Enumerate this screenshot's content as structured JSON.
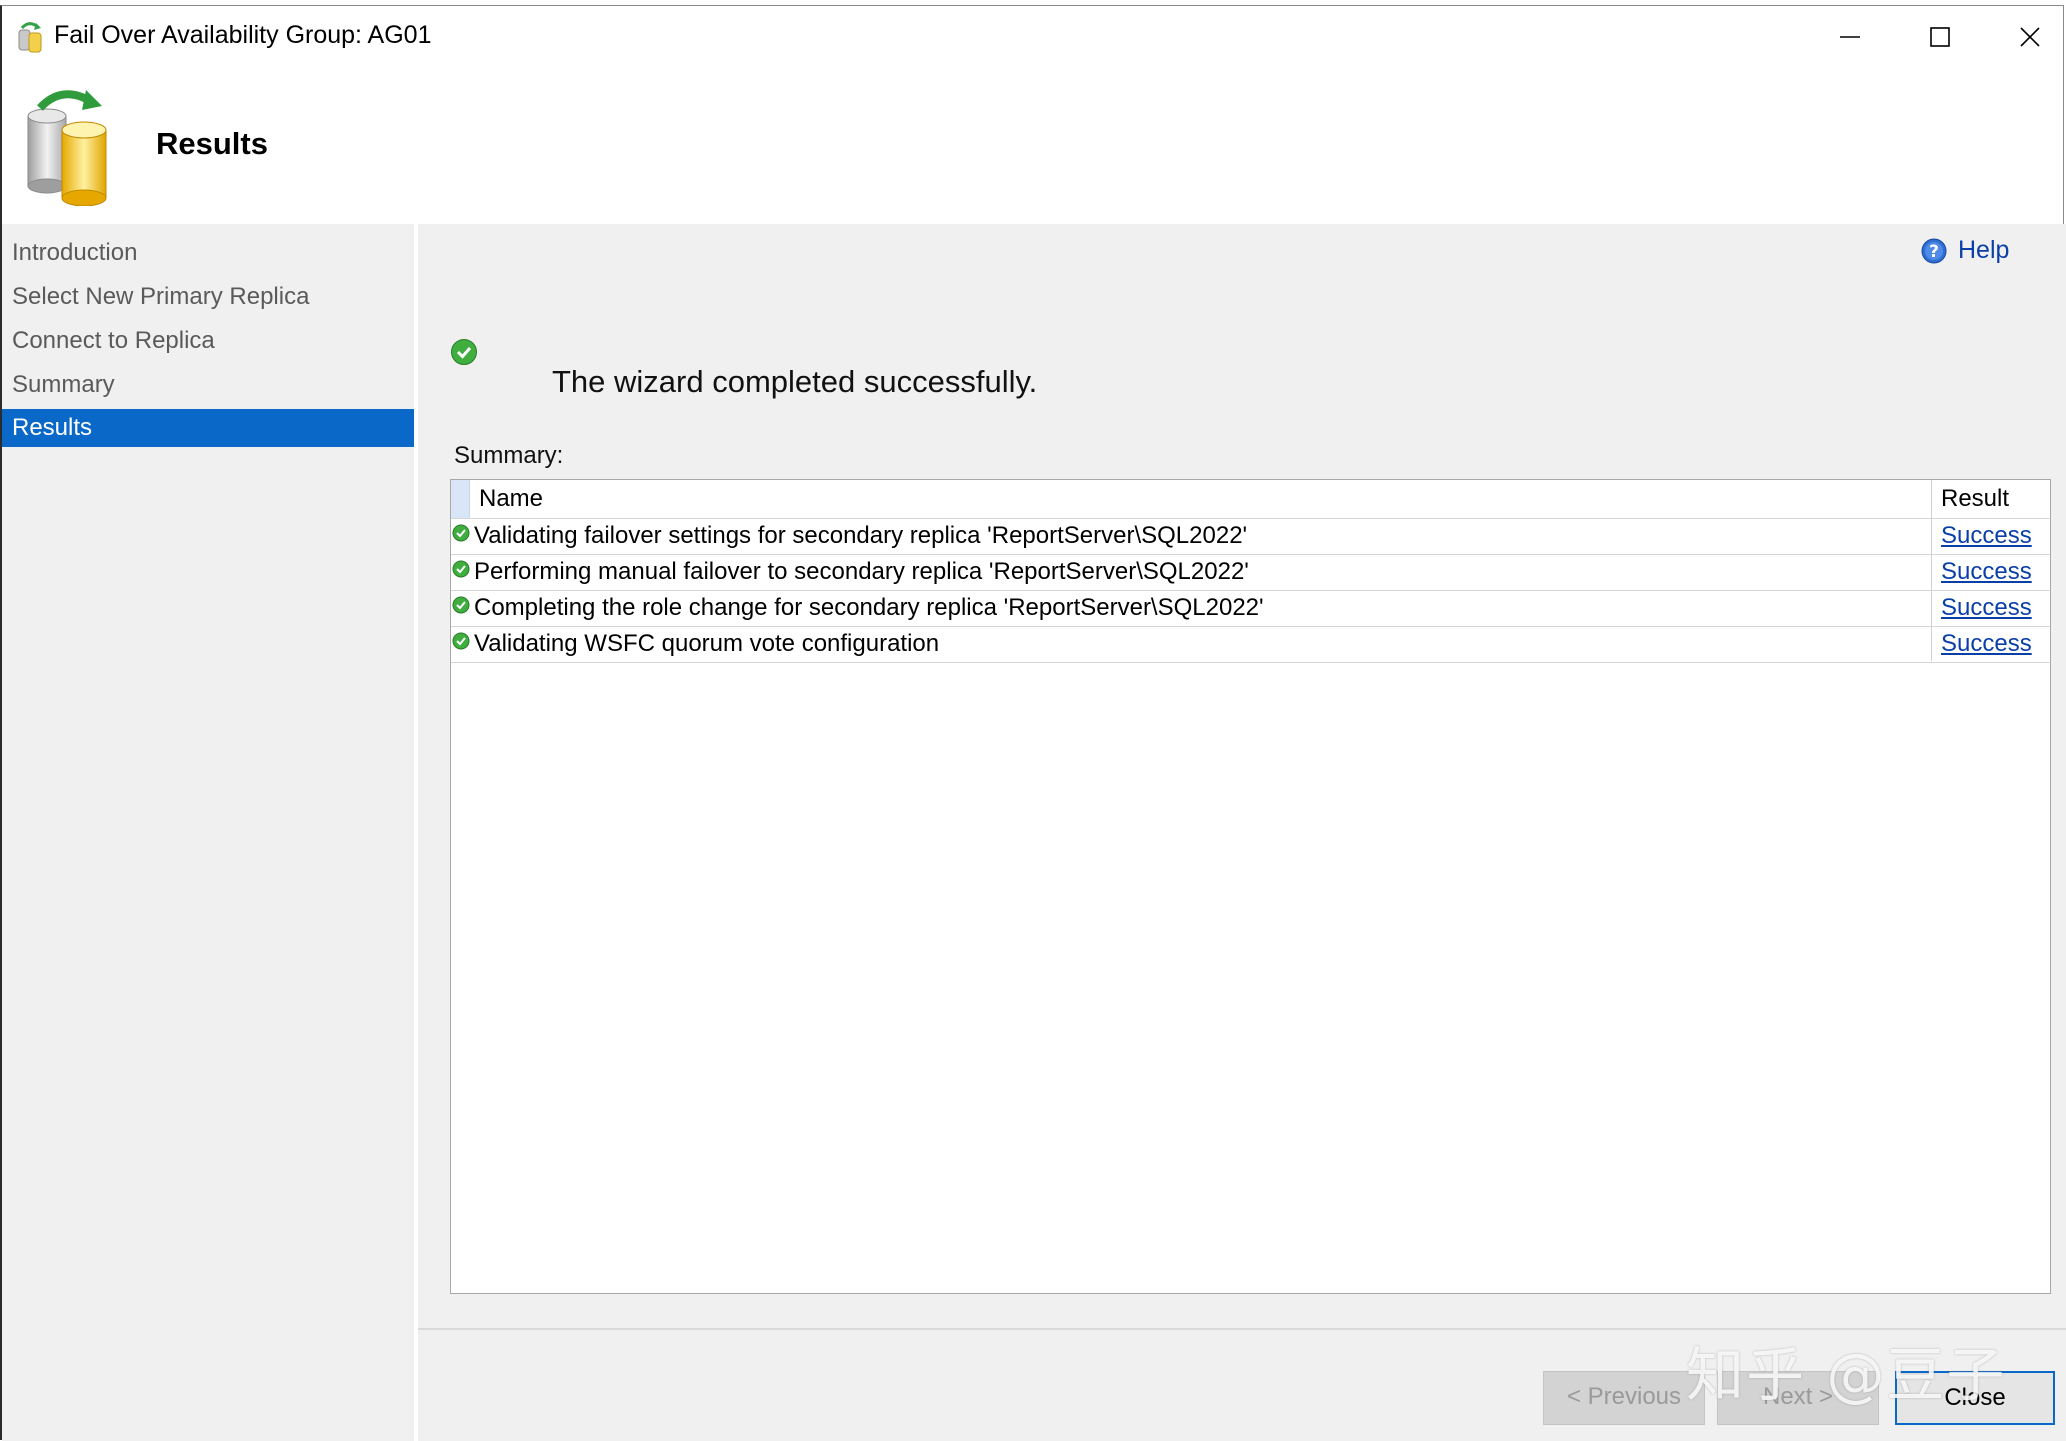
{
  "window": {
    "title": "Fail Over Availability Group: AG01",
    "controls": [
      "minimize-icon",
      "maximize-icon",
      "close-icon"
    ]
  },
  "header": {
    "title": "Results",
    "icon": "availability-group-database-icon"
  },
  "sidebar": {
    "items": [
      {
        "label": "Introduction",
        "active": false
      },
      {
        "label": "Select New Primary Replica",
        "active": false
      },
      {
        "label": "Connect to Replica",
        "active": false
      },
      {
        "label": "Summary",
        "active": false
      },
      {
        "label": "Results",
        "active": true
      }
    ]
  },
  "main": {
    "help_label": "Help",
    "status_message": "The wizard completed successfully.",
    "summary_label": "Summary:",
    "table": {
      "columns": [
        "Name",
        "Result"
      ],
      "rows": [
        {
          "name": "Validating failover settings for secondary replica 'ReportServer\\SQL2022'",
          "result": "Success"
        },
        {
          "name": "Performing manual failover to secondary replica 'ReportServer\\SQL2022'",
          "result": "Success"
        },
        {
          "name": "Completing the role change for secondary replica 'ReportServer\\SQL2022'",
          "result": "Success"
        },
        {
          "name": "Validating WSFC quorum vote configuration",
          "result": "Success"
        }
      ]
    }
  },
  "footer": {
    "previous_label": "< Previous",
    "next_label": "Next >",
    "close_label": "Close"
  },
  "watermark": "知乎 @豆子",
  "colors": {
    "accent": "#0a68c8",
    "link": "#0b3fa8",
    "panel": "#f0f0f0",
    "success": "#3fae3f"
  }
}
